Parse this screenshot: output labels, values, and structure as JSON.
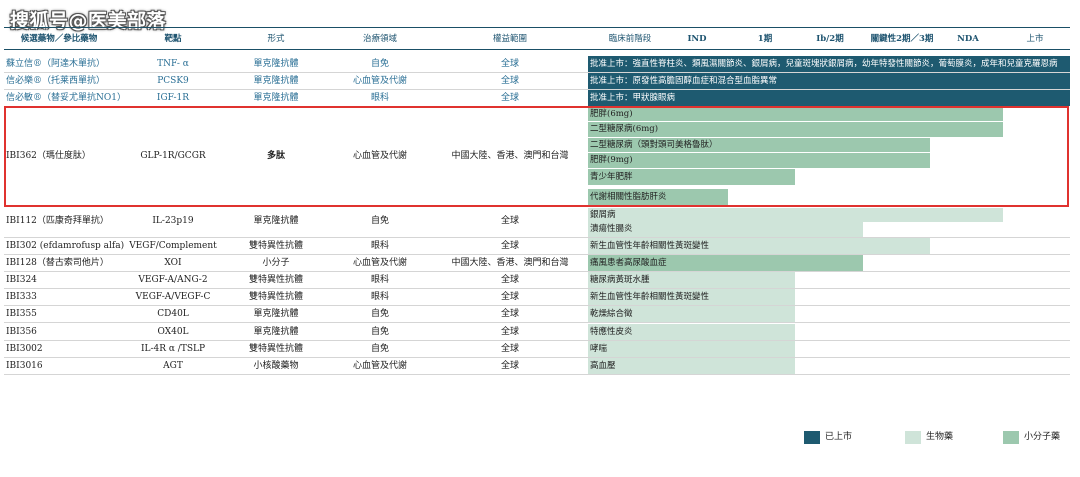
{
  "watermark": "搜狐号@医美部落",
  "headers": {
    "drug": "候選藥物／參比藥物",
    "target": "靶點",
    "form": "形式",
    "area": "治療領域",
    "rights": "權益範圍",
    "preclinical": "臨床前階段",
    "ind": "IND",
    "p1": "1期",
    "p1b2": "Ib/2期",
    "pivotal": "關鍵性2期／3期",
    "nda": "NDA",
    "launched": "上市"
  },
  "rows": [
    {
      "drug": "蘇立信®（阿達木單抗）",
      "target": "TNF- α",
      "form": "單克隆抗體",
      "area": "自免",
      "rights": "全球"
    },
    {
      "drug": "信必樂®（托莱西單抗）",
      "target": "PCSK9",
      "form": "單克隆抗體",
      "area": "心血管及代謝",
      "rights": "全球"
    },
    {
      "drug": "信必敏®（替妥尤單抗NO1）",
      "target": "IGF-1R",
      "form": "單克隆抗體",
      "area": "眼科",
      "rights": "全球"
    },
    {
      "drug": "IBI362（瑪仕度肽）",
      "target": "GLP-1R/GCGR",
      "form": "多肽",
      "area": "心血管及代謝",
      "rights": "中國大陸、香港、澳門和台灣"
    },
    {
      "drug": "IBI112（匹康奇拜單抗）",
      "target": "IL-23p19",
      "form": "單克隆抗體",
      "area": "自免",
      "rights": "全球"
    },
    {
      "drug": "IBI302 (efdamrofusp alfa)",
      "target": "VEGF/Complement",
      "form": "雙特異性抗體",
      "area": "眼科",
      "rights": "全球"
    },
    {
      "drug": "IBI128（替古索司他片）",
      "target": "XOI",
      "form": "小分子",
      "area": "心血管及代謝",
      "rights": "中國大陸、香港、澳門和台灣"
    },
    {
      "drug": "IBI324",
      "target": "VEGF-A/ANG-2",
      "form": "雙特異性抗體",
      "area": "眼科",
      "rights": "全球"
    },
    {
      "drug": "IBI333",
      "target": "VEGF-A/VEGF-C",
      "form": "雙特異性抗體",
      "area": "眼科",
      "rights": "全球"
    },
    {
      "drug": "IBI355",
      "target": "CD40L",
      "form": "單克隆抗體",
      "area": "自免",
      "rights": "全球"
    },
    {
      "drug": "IBI356",
      "target": "OX40L",
      "form": "單克隆抗體",
      "area": "自免",
      "rights": "全球"
    },
    {
      "drug": "IBI3002",
      "target": "IL-4R α /TSLP",
      "form": "雙特異性抗體",
      "area": "自免",
      "rights": "全球"
    },
    {
      "drug": "IBI3016",
      "target": "AGT",
      "form": "小核酸藥物",
      "area": "心血管及代謝",
      "rights": "全球"
    }
  ],
  "bars": [
    {
      "label": "批准上市：強直性脊柱炎、類風濕關節炎、銀屑病，兒童斑塊狀銀屑病，幼年特發性關節炎，葡萄膜炎，成年和兒童克羅恩病",
      "kind": "dark",
      "stage_end": 1.0
    },
    {
      "label": "批准上市：原發性高膽固醇血症和混合型血脂異常",
      "kind": "dark",
      "stage_end": 1.0
    },
    {
      "label": "批准上市：甲狀腺眼病",
      "kind": "dark",
      "stage_end": 1.0
    },
    {
      "label": "肥胖(6mg)",
      "kind": "mid",
      "stage_end": 0.86
    },
    {
      "label": "二型糖尿病(6mg)",
      "kind": "mid",
      "stage_end": 0.86
    },
    {
      "label": "二型糖尿病（頭對頭司美格魯肽）",
      "kind": "mid",
      "stage_end": 0.71
    },
    {
      "label": "肥胖(9mg)",
      "kind": "mid",
      "stage_end": 0.71
    },
    {
      "label": "青少年肥胖",
      "kind": "mid",
      "stage_end": 0.43
    },
    {
      "label": "代謝相關性脂肪肝炎",
      "kind": "mid",
      "stage_end": 0.29
    },
    {
      "label": "銀屑病",
      "kind": "light",
      "stage_end": 0.86
    },
    {
      "label": "潰瘍性腸炎",
      "kind": "light",
      "stage_end": 0.57
    },
    {
      "label": "新生血管性年齡相關性黃斑變性",
      "kind": "light",
      "stage_end": 0.71
    },
    {
      "label": "痛風患者高尿酸血症",
      "kind": "mid",
      "stage_end": 0.57
    },
    {
      "label": "糖尿病黃斑水腫",
      "kind": "light",
      "stage_end": 0.43
    },
    {
      "label": "新生血管性年齡相關性黃斑變性",
      "kind": "light",
      "stage_end": 0.43
    },
    {
      "label": "乾燥綜合徵",
      "kind": "light",
      "stage_end": 0.43
    },
    {
      "label": "特應性皮炎",
      "kind": "light",
      "stage_end": 0.43
    },
    {
      "label": "哮喘",
      "kind": "light",
      "stage_end": 0.43
    },
    {
      "label": "高血壓",
      "kind": "light",
      "stage_end": 0.43
    }
  ],
  "legend": [
    {
      "label": "已上市",
      "color": "#1e5a70"
    },
    {
      "label": "生物藥",
      "color": "#cfe4d9"
    },
    {
      "label": "小分子藥",
      "color": "#9cc8ae"
    }
  ]
}
